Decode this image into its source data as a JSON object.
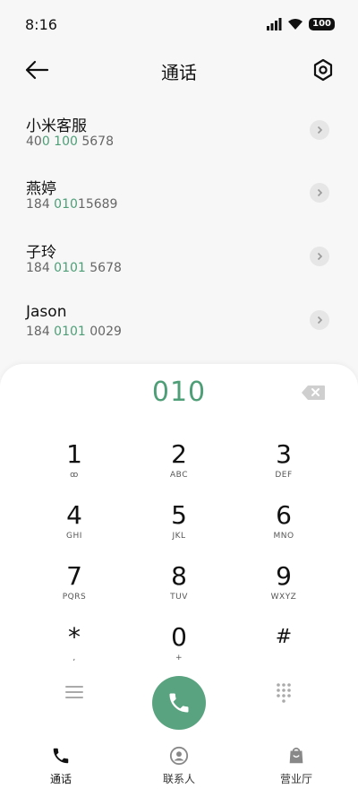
{
  "status": {
    "time": "8:16",
    "battery": "100"
  },
  "header": {
    "title": "通话"
  },
  "contacts": [
    {
      "name": "小米客服",
      "number_pre": "40",
      "number_hl": "0 100",
      "number_post": " 5678"
    },
    {
      "name": "燕婷",
      "number_pre": "184 ",
      "number_hl": "010",
      "number_post": "15689"
    },
    {
      "name": "子玲",
      "number_pre": "184 ",
      "number_hl": "0101",
      "number_post": " 5678"
    },
    {
      "name": "Jason",
      "number_pre": "184 ",
      "number_hl": "0101",
      "number_post": " 0029"
    }
  ],
  "dialpad": {
    "input": "010",
    "keys": [
      {
        "main": "1",
        "sub": "ꝏ"
      },
      {
        "main": "2",
        "sub": "ABC"
      },
      {
        "main": "3",
        "sub": "DEF"
      },
      {
        "main": "4",
        "sub": "GHI"
      },
      {
        "main": "5",
        "sub": "JKL"
      },
      {
        "main": "6",
        "sub": "MNO"
      },
      {
        "main": "7",
        "sub": "PQRS"
      },
      {
        "main": "8",
        "sub": "TUV"
      },
      {
        "main": "9",
        "sub": "WXYZ"
      },
      {
        "main": "*",
        "sub": ","
      },
      {
        "main": "0",
        "sub": "+"
      },
      {
        "main": "#",
        "sub": ""
      }
    ]
  },
  "nav": [
    {
      "label": "通话",
      "icon": "phone-icon"
    },
    {
      "label": "联系人",
      "icon": "contacts-icon"
    },
    {
      "label": "营业厅",
      "icon": "store-icon"
    }
  ],
  "colors": {
    "accent": "#4e9e78",
    "call": "#5aa380"
  }
}
